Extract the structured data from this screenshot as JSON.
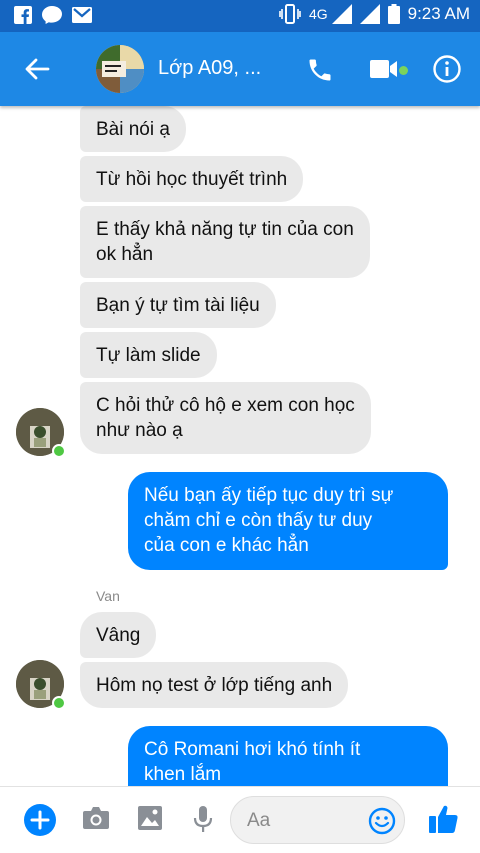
{
  "status_bar": {
    "network": "4G",
    "time": "9:23 AM",
    "icons": [
      "facebook-icon",
      "messenger-icon",
      "gmail-icon",
      "vibrate-icon",
      "signal-icon",
      "battery-icon"
    ]
  },
  "header": {
    "title": "Lớp A09, ...",
    "icons": [
      "back-arrow-icon",
      "phone-icon",
      "video-camera-icon",
      "info-icon"
    ],
    "accent": "#1e88e5"
  },
  "messages": [
    {
      "side": "in",
      "text": "Bài nói ạ"
    },
    {
      "side": "in",
      "text": "Từ hồi học thuyết trình"
    },
    {
      "side": "in",
      "line1": "E thấy khả năng tự tin của con",
      "line2": "ok hẳn"
    },
    {
      "side": "in",
      "text": "Bạn ý tự tìm tài liệu"
    },
    {
      "side": "in",
      "text": "Tự làm slide"
    },
    {
      "side": "in",
      "line1": "C hỏi thử cô hộ e xem con học",
      "line2": "như nào ạ"
    },
    {
      "side": "out",
      "line1": "Nếu bạn ấy tiếp tục duy trì sự",
      "line2": "chăm chỉ e còn thấy tư duy",
      "line3": "của con e khác hẳn"
    },
    {
      "side": "in",
      "text": "Vâng"
    },
    {
      "side": "in",
      "text": "Hôm nọ test ở lớp tiếng anh"
    },
    {
      "side": "out",
      "line1": "Cô Romani hơi khó tính ít",
      "line2": "khen lắm"
    }
  ],
  "sender_name": "Van",
  "composer": {
    "placeholder": "Aa",
    "icons": [
      "plus-icon",
      "camera-icon",
      "image-icon",
      "microphone-icon",
      "emoji-icon",
      "thumbs-up-icon"
    ]
  },
  "colors": {
    "outgoing_bubble": "#0084ff",
    "incoming_bubble": "#e9e9e9",
    "online_dot": "#4fc843"
  }
}
